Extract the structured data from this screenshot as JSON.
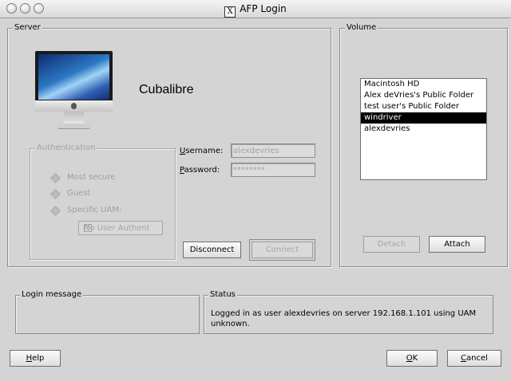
{
  "window": {
    "title": "AFP Login",
    "title_icon_glyph": "X",
    "controls": [
      "close-icon",
      "minimize-icon",
      "zoom-icon"
    ]
  },
  "server": {
    "group_label": "Server",
    "name": "Cubalibre",
    "icon": "computer-icon",
    "authentication": {
      "group_label": "Authentication",
      "options": [
        {
          "label": "Most secure",
          "enabled": false
        },
        {
          "label": "Guest",
          "enabled": false
        },
        {
          "label": "Specific UAM:",
          "enabled": false
        }
      ],
      "uam_select_value": "No User Authent",
      "uam_select_arrow": "∀"
    },
    "username": {
      "label_mnemonic": "U",
      "label_rest": "sername:",
      "value": "alexdevries"
    },
    "password": {
      "label_mnemonic": "P",
      "label_rest": "assword:",
      "value": "********"
    },
    "disconnect_label": "Disconnect",
    "connect_label": "Connect"
  },
  "volume": {
    "group_label": "Volume",
    "items": [
      {
        "label": "Macintosh HD"
      },
      {
        "label": "Alex deVries's Public Folder"
      },
      {
        "label": "test user's Public Folder"
      },
      {
        "label": "windriver"
      },
      {
        "label": "alexdevries"
      }
    ],
    "selected": "windriver",
    "detach_label": "Detach",
    "attach_label": "Attach"
  },
  "login_message": {
    "group_label": "Login message",
    "text": ""
  },
  "status": {
    "group_label": "Status",
    "text": "Logged in as user alexdevries on server 192.168.1.101 using UAM unknown."
  },
  "footer": {
    "help_mnemonic": "H",
    "help_rest": "elp",
    "ok_mnemonic": "O",
    "ok_rest": "K",
    "cancel_mnemonic": "C",
    "cancel_rest": "ancel"
  },
  "colors": {
    "window_bg": "#d4d4d4",
    "selection_bg": "#000000",
    "selection_fg": "#ffffff",
    "disabled_text": "#a3a3a3"
  }
}
